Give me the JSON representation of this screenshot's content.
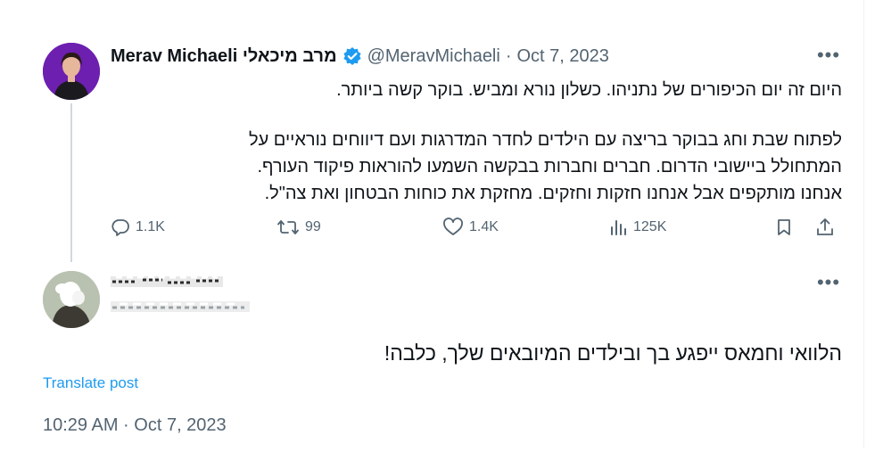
{
  "parent_tweet": {
    "display_name": "Merav Michaeli מרב מיכאלי",
    "handle": "@MeravMichaeli",
    "date": "Oct 7, 2023",
    "text_line1": "היום זה יום הכיפורים של נתניהו. כשלון נורא ומביש. בוקר קשה ביותר.",
    "text_para2": [
      "לפתוח שבת וחג בבוקר בריצה עם הילדים לחדר המדרגות ועם דיווחים נוראיים על",
      "המתחולל ביישובי הדרום. חברים וחברות בבקשה השמעו להוראות פיקוד העורף.",
      "אנחנו מותקפים אבל אנחנו חזקות וחזקים. מחזקת את כוחות הבטחון ואת צה\"ל."
    ],
    "stats": {
      "replies": "1.1K",
      "retweets": "99",
      "likes": "1.4K",
      "views": "125K"
    }
  },
  "reply_tweet": {
    "text": "הלוואי וחמאס ייפגע בך ובילדים המיובאים שלך, כלבה!",
    "translate_label": "Translate post",
    "timestamp": "10:29 AM · Oct 7, 2023"
  },
  "icons": {
    "verified": "verified-badge-icon",
    "reply": "reply-icon",
    "retweet": "retweet-icon",
    "like": "heart-icon",
    "views": "views-icon",
    "bookmark": "bookmark-icon",
    "share": "share-icon",
    "more": "more-icon"
  },
  "colors": {
    "accent": "#1d9bf0",
    "secondary_text": "#536471",
    "primary_text": "#0f1419"
  }
}
